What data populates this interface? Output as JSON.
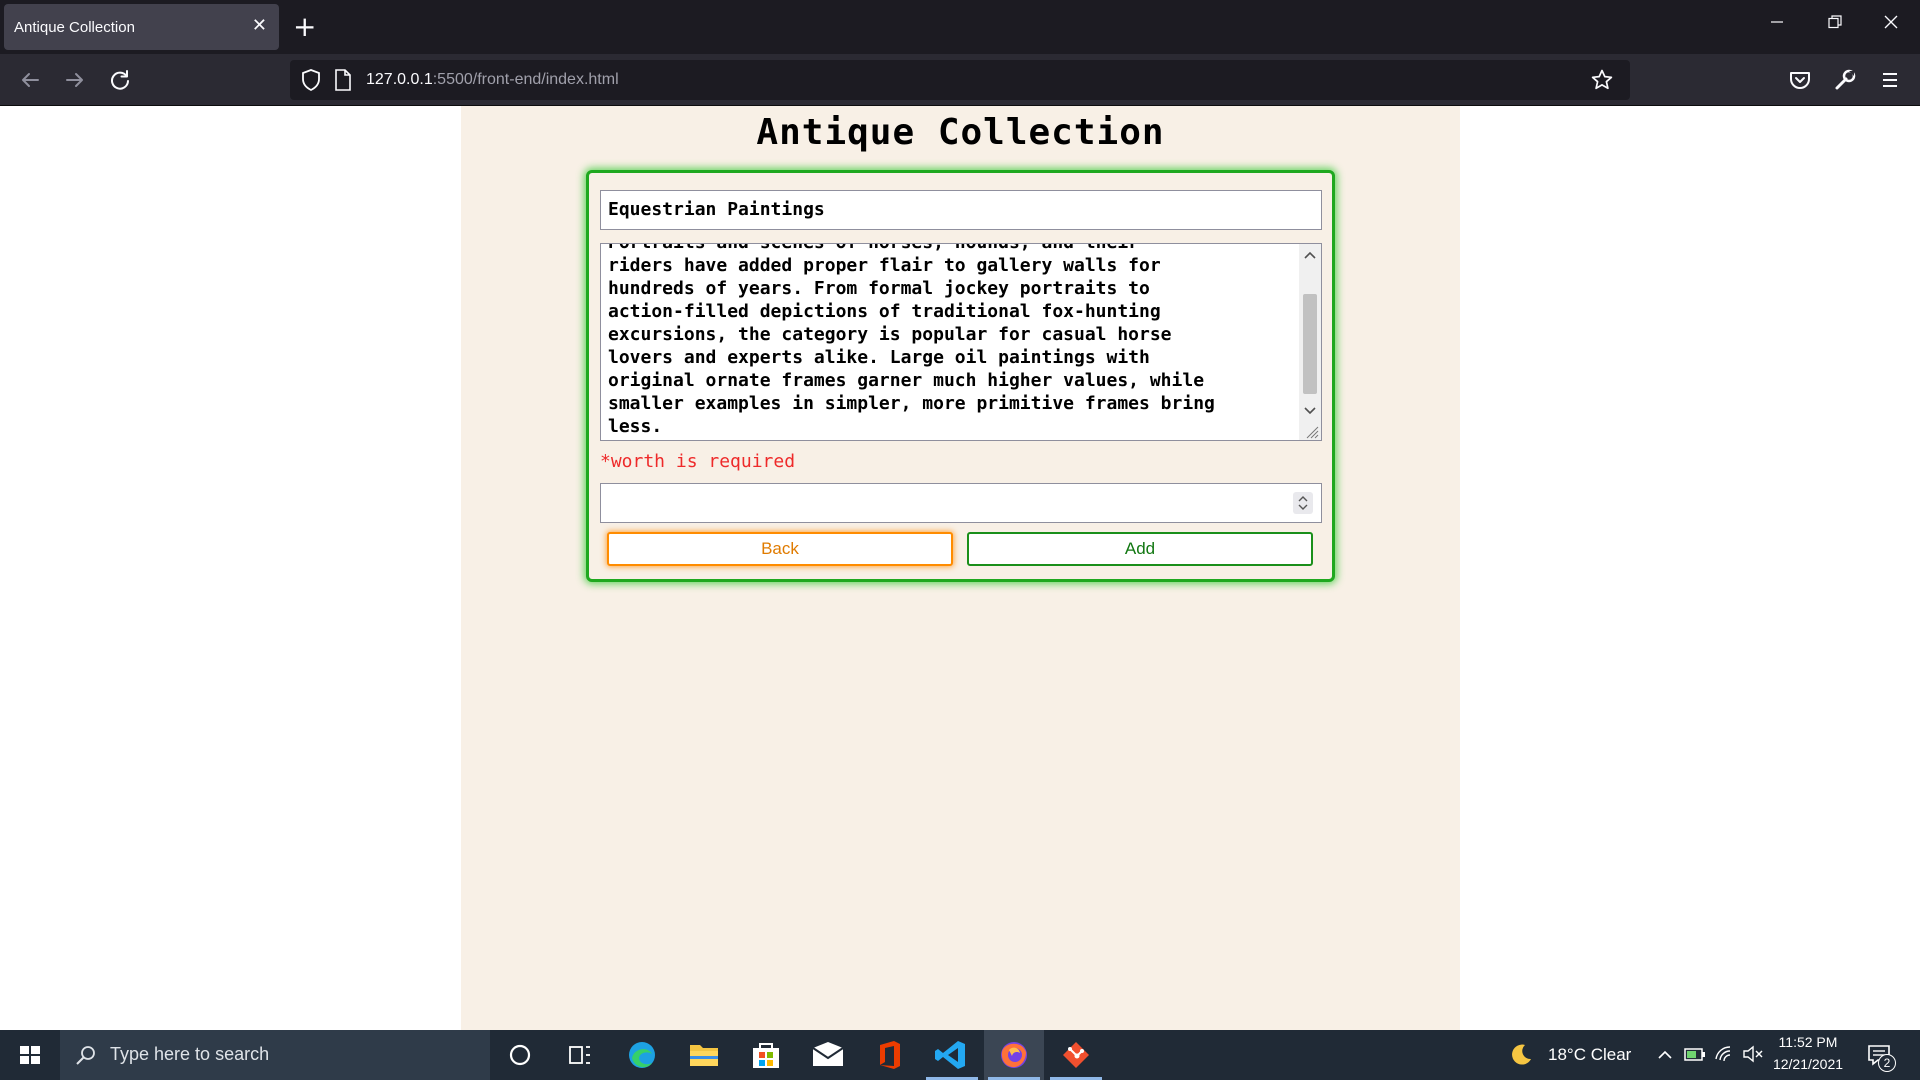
{
  "browser": {
    "tab_title": "Antique Collection",
    "url_host": "127.0.0.1",
    "url_path": ":5500/front-end/index.html"
  },
  "page": {
    "title": "Antique Collection",
    "form": {
      "name_value": "Equestrian Paintings",
      "description_value": "Portraits and scenes of horses, hounds, and their\nriders have added proper flair to gallery walls for\nhundreds of years. From formal jockey portraits to\naction-filled depictions of traditional fox-hunting\nexcursions, the category is popular for casual horse\nlovers and experts alike. Large oil paintings with\noriginal ornate frames garner much higher values, while\nsmaller examples in simpler, more primitive frames bring\nless.",
      "error_message": "*worth is required",
      "worth_value": "",
      "back_label": "Back",
      "add_label": "Add"
    }
  },
  "taskbar": {
    "search_placeholder": "Type here to search",
    "weather": "18°C  Clear",
    "time": "11:52 PM",
    "date": "12/21/2021",
    "notification_count": "2"
  },
  "colors": {
    "page_bg": "#f8f0e6",
    "card_border": "#1fa81f",
    "error": "#ee2a2a",
    "back_border": "#ff8c00",
    "add_border": "#1a8f1a"
  }
}
